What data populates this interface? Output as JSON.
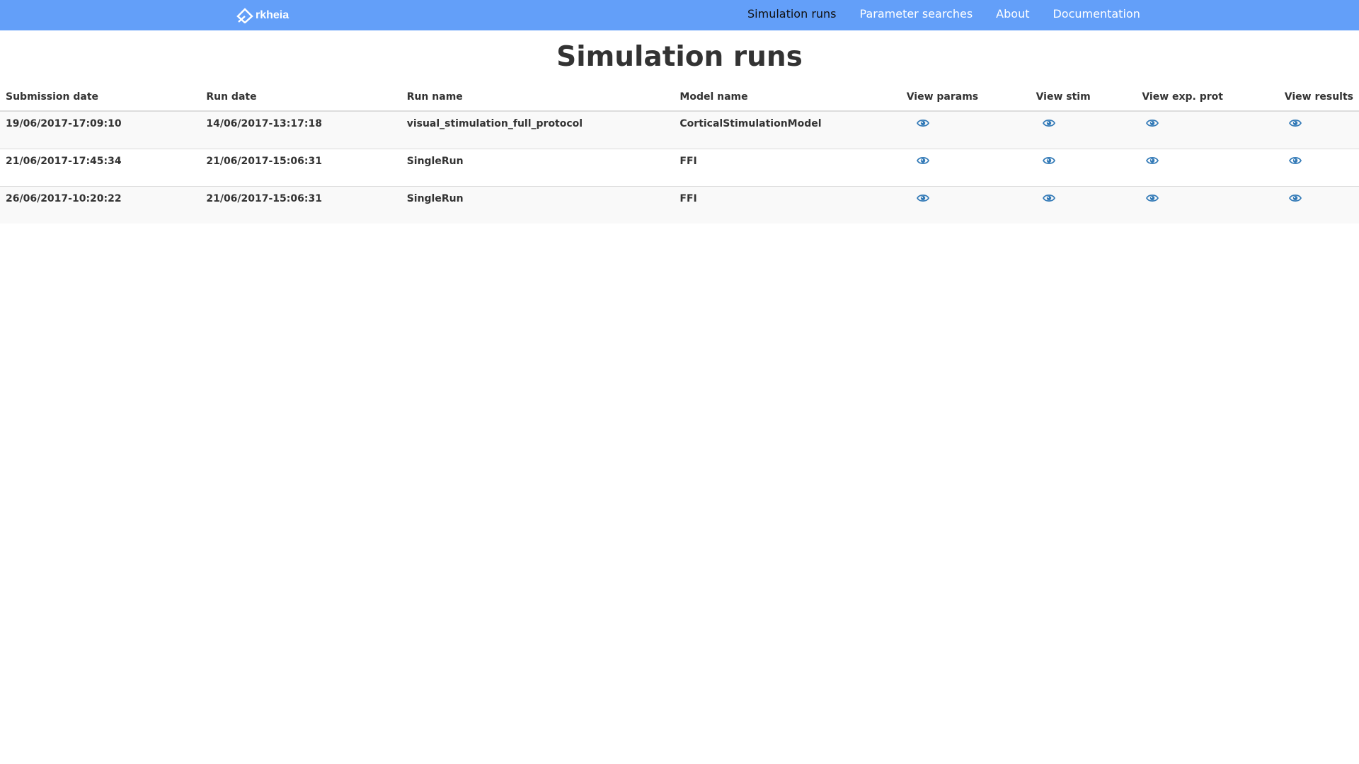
{
  "navbar": {
    "brand": "rkheia",
    "brand_logo_icon": "arkheia-logo-icon",
    "color": "#639ff9",
    "links": [
      {
        "label": "Simulation runs",
        "active": true
      },
      {
        "label": "Parameter searches",
        "active": false
      },
      {
        "label": "About",
        "active": false
      },
      {
        "label": "Documentation",
        "active": false
      }
    ]
  },
  "page": {
    "title": "Simulation runs"
  },
  "table": {
    "headers": [
      "Submission date",
      "Run date",
      "Run name",
      "Model name",
      "View params",
      "View stim",
      "View exp. prot",
      "View results"
    ],
    "eye_icon": "eye-icon",
    "eye_color": "#337ab7",
    "rows": [
      {
        "submission_date": "19/06/2017-17:09:10",
        "run_date": "14/06/2017-13:17:18",
        "run_name": "visual_stimulation_full_protocol",
        "model_name": "CorticalStimulationModel"
      },
      {
        "submission_date": "21/06/2017-17:45:34",
        "run_date": "21/06/2017-15:06:31",
        "run_name": "SingleRun",
        "model_name": "FFI"
      },
      {
        "submission_date": "26/06/2017-10:20:22",
        "run_date": "21/06/2017-15:06:31",
        "run_name": "SingleRun",
        "model_name": "FFI"
      }
    ]
  }
}
